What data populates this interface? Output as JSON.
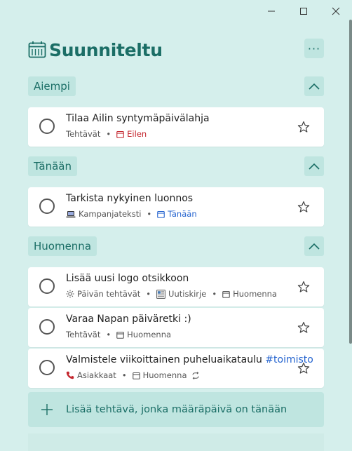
{
  "window": {
    "minimize_label": "",
    "maximize_label": "",
    "close_label": ""
  },
  "header": {
    "title": "Suunniteltu",
    "more_label": "···",
    "icon": "calendar-icon"
  },
  "sections": {
    "earlier": {
      "label": "Aiempi"
    },
    "today": {
      "label": "Tänään"
    },
    "tomorrow": {
      "label": "Huomenna"
    }
  },
  "tasks": {
    "t1": {
      "title": "Tilaa Ailin syntymäpäivälahja",
      "list": "Tehtävät",
      "due": "Eilen"
    },
    "t2": {
      "title": "Tarkista nykyinen luonnos",
      "list": "Kampanjateksti",
      "due": "Tänään"
    },
    "t3": {
      "title": "Lisää uusi logo otsikkoon",
      "list": "Päivän tehtävät",
      "list2": "Uutiskirje",
      "due": "Huomenna"
    },
    "t4": {
      "title": "Varaa Napan päiväretki :)",
      "list": "Tehtävät",
      "due": "Huomenna"
    },
    "t5": {
      "title": "Valmistele viikoittainen puheluaikataulu",
      "tag": "#toimisto",
      "list": "Asiakkaat",
      "due": "Huomenna"
    }
  },
  "add_task": {
    "label": "Lisää tehtävä, jonka määräpäivä on tänään"
  },
  "colors": {
    "accent": "#1b6e66",
    "background": "#d5efec",
    "overdue": "#c4262e",
    "today": "#2564cf"
  }
}
